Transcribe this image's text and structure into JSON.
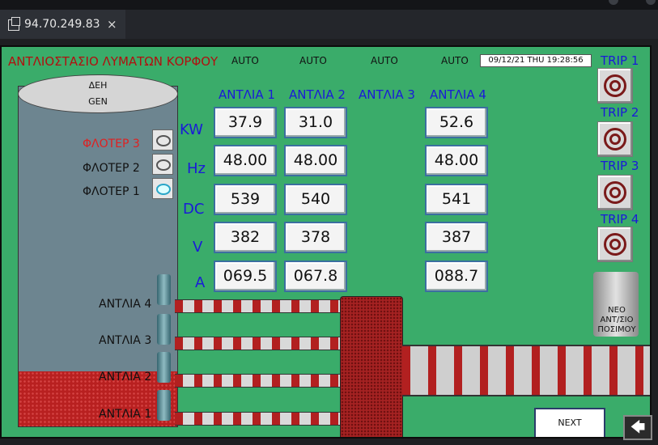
{
  "browser": {
    "tab_title": "94.70.249.83",
    "close_glyph": "×"
  },
  "hmi": {
    "title": "ΑΝΤΛΙΟΣΤΑΣΙΟ ΛΥΜΑΤΩΝ ΚΟΡΦΟΥ",
    "auto_labels": [
      "AUTO",
      "AUTO",
      "AUTO",
      "AUTO"
    ],
    "datetime": "09/12/21 THU 19:28:56",
    "tank": {
      "top_line1": "ΔΕΗ",
      "top_line2": "GEN"
    },
    "floters": [
      {
        "label": "ΦΛΟΤΕΡ 3",
        "active": true,
        "color": "#e02020"
      },
      {
        "label": "ΦΛΟΤΕΡ 2",
        "active": false
      },
      {
        "label": "ΦΛΟΤΕΡ 1",
        "active": false
      }
    ],
    "pump_headers": [
      "ΑΝΤΛΙΑ 1",
      "ΑΝΤΛΙΑ 2",
      "ΑΝΤΛΙΑ 3",
      "ΑΝΤΛΙΑ 4"
    ],
    "row_labels": [
      "KW",
      "Hz",
      "DC",
      "V",
      "A"
    ],
    "values": {
      "pump1": [
        "37.9",
        "48.00",
        "539",
        "382",
        "069.5"
      ],
      "pump2": [
        "31.0",
        "48.00",
        "540",
        "378",
        "067.8"
      ],
      "pump4": [
        "52.6",
        "48.00",
        "541",
        "387",
        "088.7"
      ]
    },
    "trips": [
      "TRIP 1",
      "TRIP 2",
      "TRIP 3",
      "TRIP 4"
    ],
    "pumps_side": [
      "ΑΝΤΛΙΑ 4",
      "ΑΝΤΛΙΑ 3",
      "ΑΝΤΛΙΑ 2",
      "ΑΝΤΛΙΑ 1"
    ],
    "barrel_label": [
      "ΝΕΟ",
      "ΑΝΤ/ΣΙΟ",
      "ΠΟΣΙΜΟΥ"
    ],
    "next_label": "NEXT",
    "back_glyph": "🡄"
  },
  "colors": {
    "background": "#3aac6a",
    "title": "#b01010",
    "header": "#1a1ad8"
  }
}
